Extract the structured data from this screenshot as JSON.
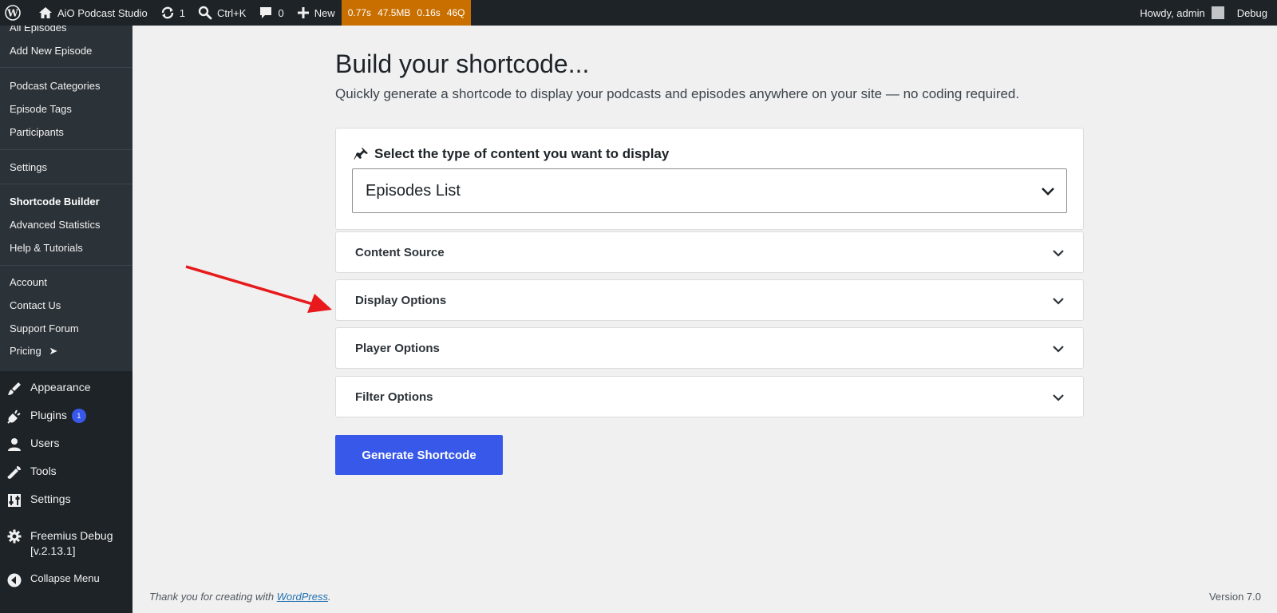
{
  "adminbar": {
    "site_name": "AiO Podcast Studio",
    "updates_count": "1",
    "search_shortcut": "Ctrl+K",
    "comments_count": "0",
    "new_label": "New",
    "perf_time": "0.77s",
    "perf_memory": "47.5MB",
    "perf_query_time": "0.16s",
    "perf_queries": "46Q",
    "howdy": "Howdy, admin",
    "debug": "Debug"
  },
  "sidebar": {
    "submenu": {
      "all_episodes": "All Episodes",
      "add_new_episode": "Add New Episode",
      "podcast_categories": "Podcast Categories",
      "episode_tags": "Episode Tags",
      "participants": "Participants",
      "settings": "Settings",
      "shortcode_builder": "Shortcode Builder",
      "advanced_statistics": "Advanced Statistics",
      "help_tutorials": "Help & Tutorials",
      "account": "Account",
      "contact_us": "Contact Us",
      "support_forum": "Support Forum",
      "pricing": "Pricing",
      "pricing_arrow": "➤"
    },
    "menu": {
      "appearance": "Appearance",
      "plugins": "Plugins",
      "plugins_badge": "1",
      "users": "Users",
      "tools": "Tools",
      "settings": "Settings",
      "freemius_line1": "Freemius Debug",
      "freemius_line2": "[v.2.13.1]",
      "collapse": "Collapse Menu"
    }
  },
  "main": {
    "title": "Build your shortcode...",
    "description": "Quickly generate a shortcode to display your podcasts and episodes anywhere on your site — no coding required.",
    "select_label": "Select the type of content you want to display",
    "select_value": "Episodes List",
    "sections": [
      {
        "label": "Content Source"
      },
      {
        "label": "Display Options"
      },
      {
        "label": "Player Options"
      },
      {
        "label": "Filter Options"
      }
    ],
    "generate_button": "Generate Shortcode"
  },
  "footer": {
    "thanks_prefix": "Thank you for creating with ",
    "thanks_link": "WordPress",
    "thanks_suffix": ".",
    "version": "Version 7.0"
  },
  "colors": {
    "accent": "#3858e9",
    "admin_bg": "#1d2327",
    "perf_bg": "#c86f00",
    "annotation_arrow": "#e8191a"
  }
}
